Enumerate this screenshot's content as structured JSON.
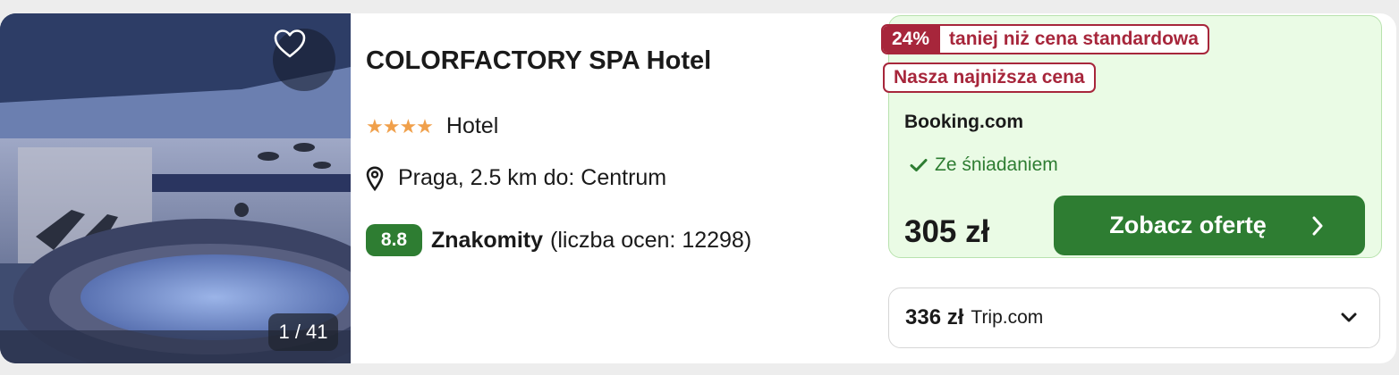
{
  "hotel": {
    "name": "COLORFACTORY SPA Hotel",
    "stars_glyph": "★★★★",
    "type": "Hotel",
    "location": "Praga, 2.5 km do: Centrum",
    "rating_score": "8.8",
    "rating_label": "Znakomity",
    "rating_count": "(liczba ocen: 12298)"
  },
  "gallery": {
    "counter": "1 / 41"
  },
  "offer": {
    "discount_pct": "24%",
    "discount_text": "taniej niż cena standardowa",
    "lowest_badge": "Nasza najniższa cena",
    "provider": "Booking.com",
    "feature": "Ze śniadaniem",
    "price": "305 zł",
    "cta_label": "Zobacz ofertę"
  },
  "alt_offer": {
    "price": "336 zł",
    "provider": "Trip.com"
  },
  "colors": {
    "accent_green": "#2e7d32",
    "badge_red": "#a7263b",
    "star_orange": "#f0a04b",
    "offer_bg": "#eafbe5"
  },
  "icons": [
    "heart-icon",
    "location-pin-icon",
    "check-icon",
    "chevron-right-icon",
    "chevron-down-icon"
  ]
}
